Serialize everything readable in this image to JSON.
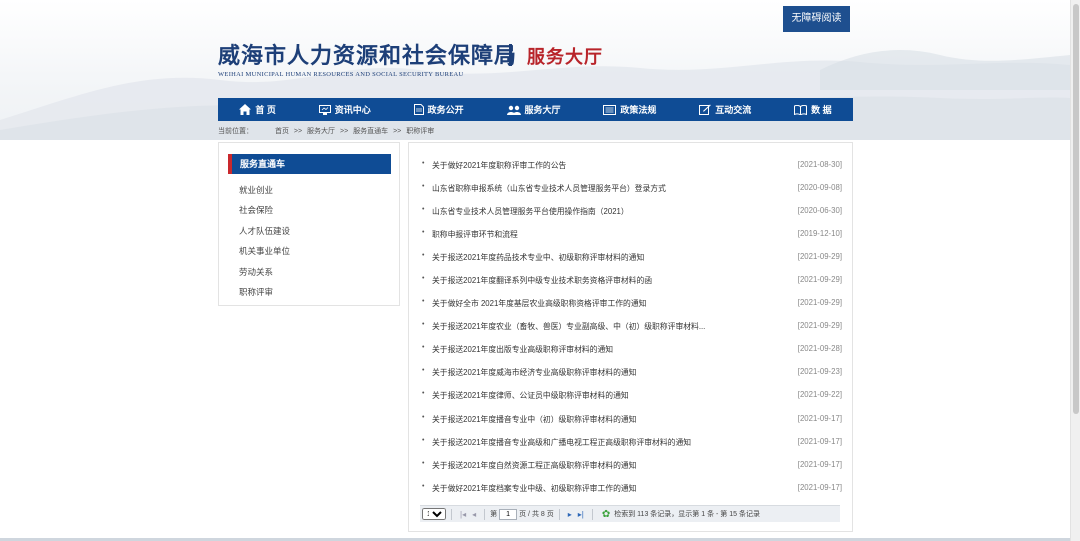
{
  "header": {
    "accessibility_label": "无障碍阅读",
    "logo_cn": "威海市人力资源和社会保障局",
    "logo_en": "WEIHAI MUNICIPAL HUMAN RESOURCES AND SOCIAL SECURITY BUREAU",
    "hall_title": "服务大厅"
  },
  "nav": {
    "items": [
      {
        "label": "首 页",
        "icon": "home-icon"
      },
      {
        "label": "资讯中心",
        "icon": "monitor-icon"
      },
      {
        "label": "政务公开",
        "icon": "document-icon"
      },
      {
        "label": "服务大厅",
        "icon": "people-icon"
      },
      {
        "label": "政策法规",
        "icon": "list-icon"
      },
      {
        "label": "互动交流",
        "icon": "edit-icon"
      },
      {
        "label": "数 据",
        "icon": "book-icon"
      }
    ]
  },
  "breadcrumb": {
    "label": "当前位置：",
    "path": [
      "首页",
      ">>",
      "服务大厅",
      ">>",
      "服务直通车",
      ">>",
      "职称评审"
    ]
  },
  "sidebar": {
    "title": "服务直通车",
    "items": [
      "就业创业",
      "社会保险",
      "人才队伍建设",
      "机关事业单位",
      "劳动关系",
      "职称评审"
    ]
  },
  "news": [
    {
      "title": "关于做好2021年度职称评审工作的公告",
      "date": "[2021-08-30]"
    },
    {
      "title": "山东省职称申报系统（山东省专业技术人员管理服务平台）登录方式",
      "date": "[2020-09-08]"
    },
    {
      "title": "山东省专业技术人员管理服务平台使用操作指南（2021）",
      "date": "[2020-06-30]"
    },
    {
      "title": "职称申报评审环节和流程",
      "date": "[2019-12-10]"
    },
    {
      "title": "关于报送2021年度药品技术专业中、初级职称评审材料的通知",
      "date": "[2021-09-29]"
    },
    {
      "title": "关于报送2021年度翻译系列中级专业技术职务资格评审材料的函",
      "date": "[2021-09-29]"
    },
    {
      "title": "关于做好全市 2021年度基层农业高级职称资格评审工作的通知",
      "date": "[2021-09-29]"
    },
    {
      "title": "关于报送2021年度农业（畜牧、兽医）专业副高级、中（初）级职称评审材料...",
      "date": "[2021-09-29]"
    },
    {
      "title": "关于报送2021年度出版专业高级职称评审材料的通知",
      "date": "[2021-09-28]"
    },
    {
      "title": "关于报送2021年度威海市经济专业高级职称评审材料的通知",
      "date": "[2021-09-23]"
    },
    {
      "title": "关于报送2021年度律师、公证员中级职称评审材料的通知",
      "date": "[2021-09-22]"
    },
    {
      "title": "关于报送2021年度播音专业中（初）级职称评审材料的通知",
      "date": "[2021-09-17]"
    },
    {
      "title": "关于报送2021年度播音专业高级和广播电视工程正高级职称评审材料的通知",
      "date": "[2021-09-17]"
    },
    {
      "title": "关于报送2021年度自然资源工程正高级职称评审材料的通知",
      "date": "[2021-09-17]"
    },
    {
      "title": "关于做好2021年度档案专业中级、初级职称评审工作的通知",
      "date": "[2021-09-17]"
    }
  ],
  "pager": {
    "page_size": "15",
    "page_prefix": "第",
    "page_value": "1",
    "page_suffix": "页 / 共 8 页",
    "summary": "检索到 113 条记录，显示第 1 条 - 第 15 条记录"
  },
  "colors": {
    "nav_bg": "#0f4c95",
    "logo_blue": "#1d3f78",
    "hall_red": "#b8242a",
    "side_accent": "#c9282d"
  }
}
